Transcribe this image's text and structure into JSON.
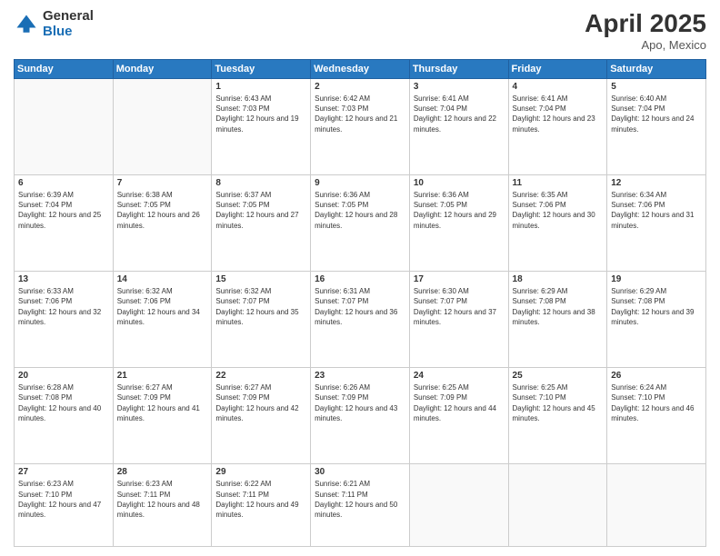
{
  "header": {
    "logo_general": "General",
    "logo_blue": "Blue",
    "month_title": "April 2025",
    "location": "Apo, Mexico"
  },
  "days_of_week": [
    "Sunday",
    "Monday",
    "Tuesday",
    "Wednesday",
    "Thursday",
    "Friday",
    "Saturday"
  ],
  "weeks": [
    [
      {
        "day": "",
        "info": ""
      },
      {
        "day": "",
        "info": ""
      },
      {
        "day": "1",
        "info": "Sunrise: 6:43 AM\nSunset: 7:03 PM\nDaylight: 12 hours and 19 minutes."
      },
      {
        "day": "2",
        "info": "Sunrise: 6:42 AM\nSunset: 7:03 PM\nDaylight: 12 hours and 21 minutes."
      },
      {
        "day": "3",
        "info": "Sunrise: 6:41 AM\nSunset: 7:04 PM\nDaylight: 12 hours and 22 minutes."
      },
      {
        "day": "4",
        "info": "Sunrise: 6:41 AM\nSunset: 7:04 PM\nDaylight: 12 hours and 23 minutes."
      },
      {
        "day": "5",
        "info": "Sunrise: 6:40 AM\nSunset: 7:04 PM\nDaylight: 12 hours and 24 minutes."
      }
    ],
    [
      {
        "day": "6",
        "info": "Sunrise: 6:39 AM\nSunset: 7:04 PM\nDaylight: 12 hours and 25 minutes."
      },
      {
        "day": "7",
        "info": "Sunrise: 6:38 AM\nSunset: 7:05 PM\nDaylight: 12 hours and 26 minutes."
      },
      {
        "day": "8",
        "info": "Sunrise: 6:37 AM\nSunset: 7:05 PM\nDaylight: 12 hours and 27 minutes."
      },
      {
        "day": "9",
        "info": "Sunrise: 6:36 AM\nSunset: 7:05 PM\nDaylight: 12 hours and 28 minutes."
      },
      {
        "day": "10",
        "info": "Sunrise: 6:36 AM\nSunset: 7:05 PM\nDaylight: 12 hours and 29 minutes."
      },
      {
        "day": "11",
        "info": "Sunrise: 6:35 AM\nSunset: 7:06 PM\nDaylight: 12 hours and 30 minutes."
      },
      {
        "day": "12",
        "info": "Sunrise: 6:34 AM\nSunset: 7:06 PM\nDaylight: 12 hours and 31 minutes."
      }
    ],
    [
      {
        "day": "13",
        "info": "Sunrise: 6:33 AM\nSunset: 7:06 PM\nDaylight: 12 hours and 32 minutes."
      },
      {
        "day": "14",
        "info": "Sunrise: 6:32 AM\nSunset: 7:06 PM\nDaylight: 12 hours and 34 minutes."
      },
      {
        "day": "15",
        "info": "Sunrise: 6:32 AM\nSunset: 7:07 PM\nDaylight: 12 hours and 35 minutes."
      },
      {
        "day": "16",
        "info": "Sunrise: 6:31 AM\nSunset: 7:07 PM\nDaylight: 12 hours and 36 minutes."
      },
      {
        "day": "17",
        "info": "Sunrise: 6:30 AM\nSunset: 7:07 PM\nDaylight: 12 hours and 37 minutes."
      },
      {
        "day": "18",
        "info": "Sunrise: 6:29 AM\nSunset: 7:08 PM\nDaylight: 12 hours and 38 minutes."
      },
      {
        "day": "19",
        "info": "Sunrise: 6:29 AM\nSunset: 7:08 PM\nDaylight: 12 hours and 39 minutes."
      }
    ],
    [
      {
        "day": "20",
        "info": "Sunrise: 6:28 AM\nSunset: 7:08 PM\nDaylight: 12 hours and 40 minutes."
      },
      {
        "day": "21",
        "info": "Sunrise: 6:27 AM\nSunset: 7:09 PM\nDaylight: 12 hours and 41 minutes."
      },
      {
        "day": "22",
        "info": "Sunrise: 6:27 AM\nSunset: 7:09 PM\nDaylight: 12 hours and 42 minutes."
      },
      {
        "day": "23",
        "info": "Sunrise: 6:26 AM\nSunset: 7:09 PM\nDaylight: 12 hours and 43 minutes."
      },
      {
        "day": "24",
        "info": "Sunrise: 6:25 AM\nSunset: 7:09 PM\nDaylight: 12 hours and 44 minutes."
      },
      {
        "day": "25",
        "info": "Sunrise: 6:25 AM\nSunset: 7:10 PM\nDaylight: 12 hours and 45 minutes."
      },
      {
        "day": "26",
        "info": "Sunrise: 6:24 AM\nSunset: 7:10 PM\nDaylight: 12 hours and 46 minutes."
      }
    ],
    [
      {
        "day": "27",
        "info": "Sunrise: 6:23 AM\nSunset: 7:10 PM\nDaylight: 12 hours and 47 minutes."
      },
      {
        "day": "28",
        "info": "Sunrise: 6:23 AM\nSunset: 7:11 PM\nDaylight: 12 hours and 48 minutes."
      },
      {
        "day": "29",
        "info": "Sunrise: 6:22 AM\nSunset: 7:11 PM\nDaylight: 12 hours and 49 minutes."
      },
      {
        "day": "30",
        "info": "Sunrise: 6:21 AM\nSunset: 7:11 PM\nDaylight: 12 hours and 50 minutes."
      },
      {
        "day": "",
        "info": ""
      },
      {
        "day": "",
        "info": ""
      },
      {
        "day": "",
        "info": ""
      }
    ]
  ]
}
